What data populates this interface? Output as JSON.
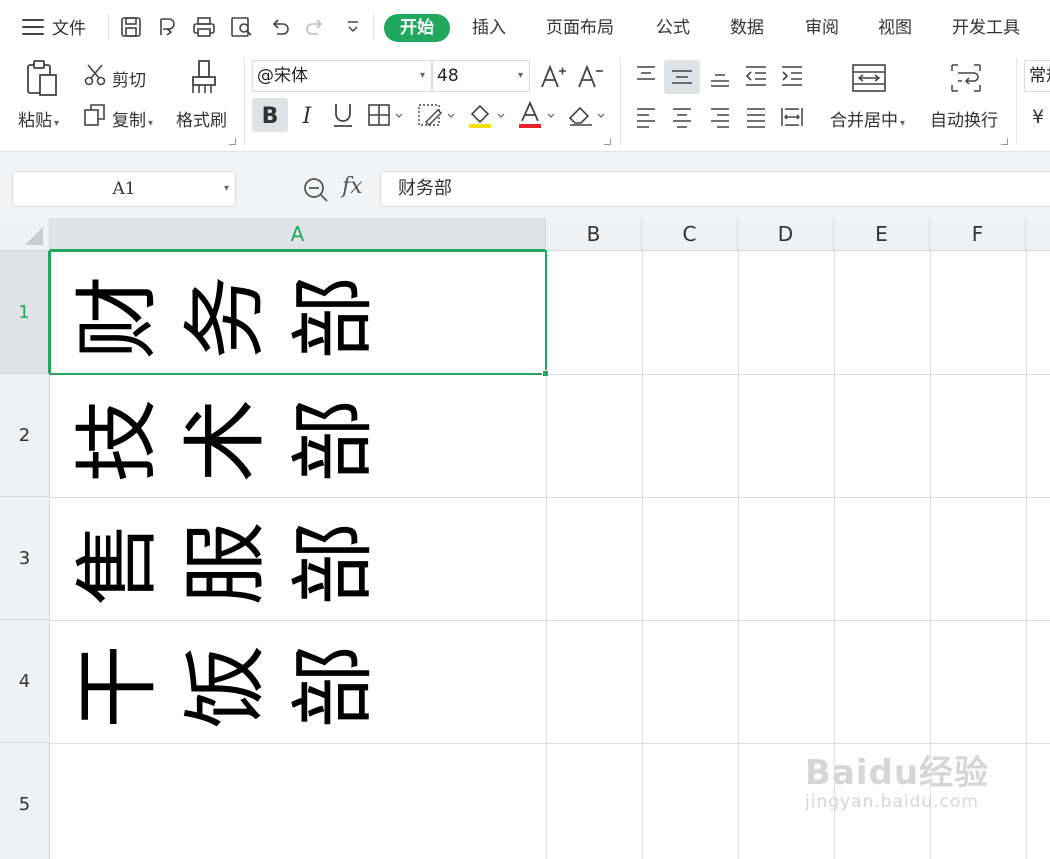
{
  "menubar": {
    "file_label": "文件",
    "tabs": [
      "开始",
      "插入",
      "页面布局",
      "公式",
      "数据",
      "审阅",
      "视图",
      "开发工具"
    ],
    "active_tab": "开始",
    "accent_color": "#1fa85e"
  },
  "ribbon": {
    "paste_label": "粘贴",
    "cut_label": "剪切",
    "copy_label": "复制",
    "format_painter_label": "格式刷",
    "font_name": "@宋体",
    "font_size": "48",
    "merge_center_label": "合并居中",
    "wrap_text_label": "自动换行",
    "number_format_partial": "常规",
    "percent_partial": "¥"
  },
  "formula_bar": {
    "name_box": "A1",
    "fx_label": "fx",
    "content": "财务部"
  },
  "grid": {
    "columns": [
      "A",
      "B",
      "C",
      "D",
      "E",
      "F"
    ],
    "rows": [
      "1",
      "2",
      "3",
      "4",
      "5"
    ],
    "selected_cell": "A1",
    "cells_A": [
      "财务部",
      "技术部",
      "售服部",
      "干饭部",
      ""
    ]
  },
  "watermark": {
    "main": "Baidu经验",
    "sub": "jingyan.baidu.com"
  }
}
